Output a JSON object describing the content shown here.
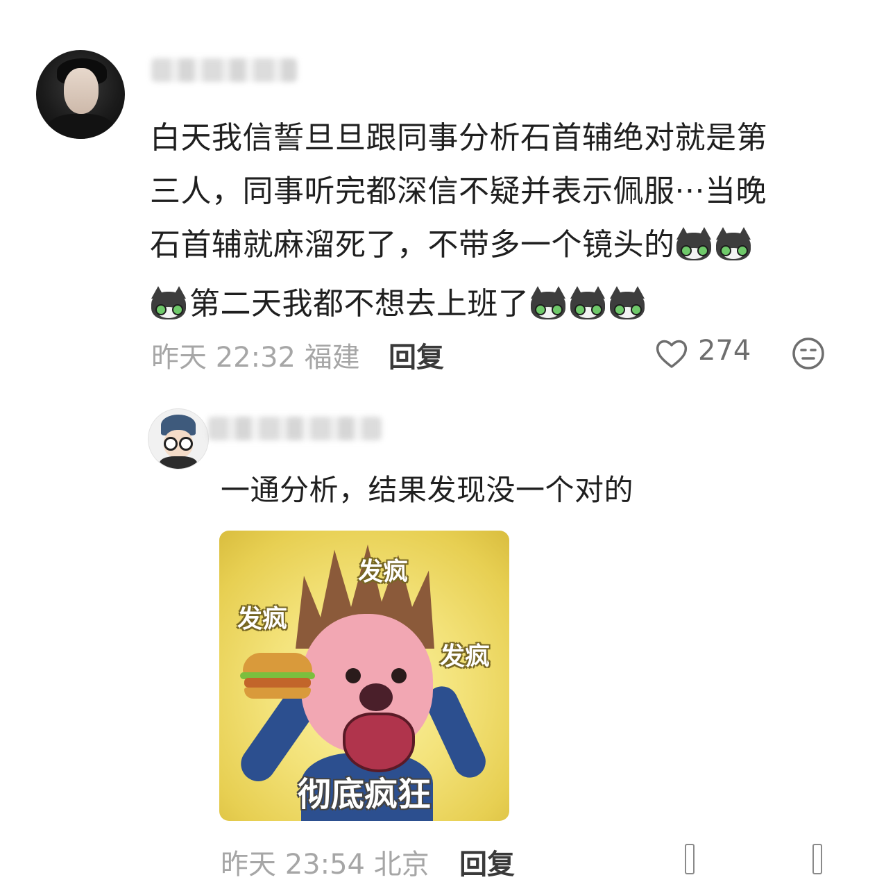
{
  "comment": {
    "text_line1": "白天我信誓旦旦跟同事分析石首辅绝对就是第",
    "text_line2": "三人，同事听完都深信不疑并表示佩服···当晚",
    "text_line3": "石首辅就麻溜死了，不带多一个镜头的",
    "text_line4": "第二天我都不想去上班了",
    "emoji_name": "cat-emoji-icon",
    "date": "昨天 22:32 福建",
    "reply_label": "回复",
    "like_count": "274"
  },
  "reply": {
    "text": "一通分析，结果发现没一个对的",
    "meme": {
      "words": [
        "发疯",
        "发疯",
        "发疯"
      ],
      "caption": "彻底疯狂"
    },
    "date": "昨天 23:54 北京",
    "reply_label": "回复"
  },
  "colors": {
    "text": "#1f1f1f",
    "meta": "#a6a6a6",
    "reply_action": "#3a3a3a",
    "background": "#ffffff"
  }
}
